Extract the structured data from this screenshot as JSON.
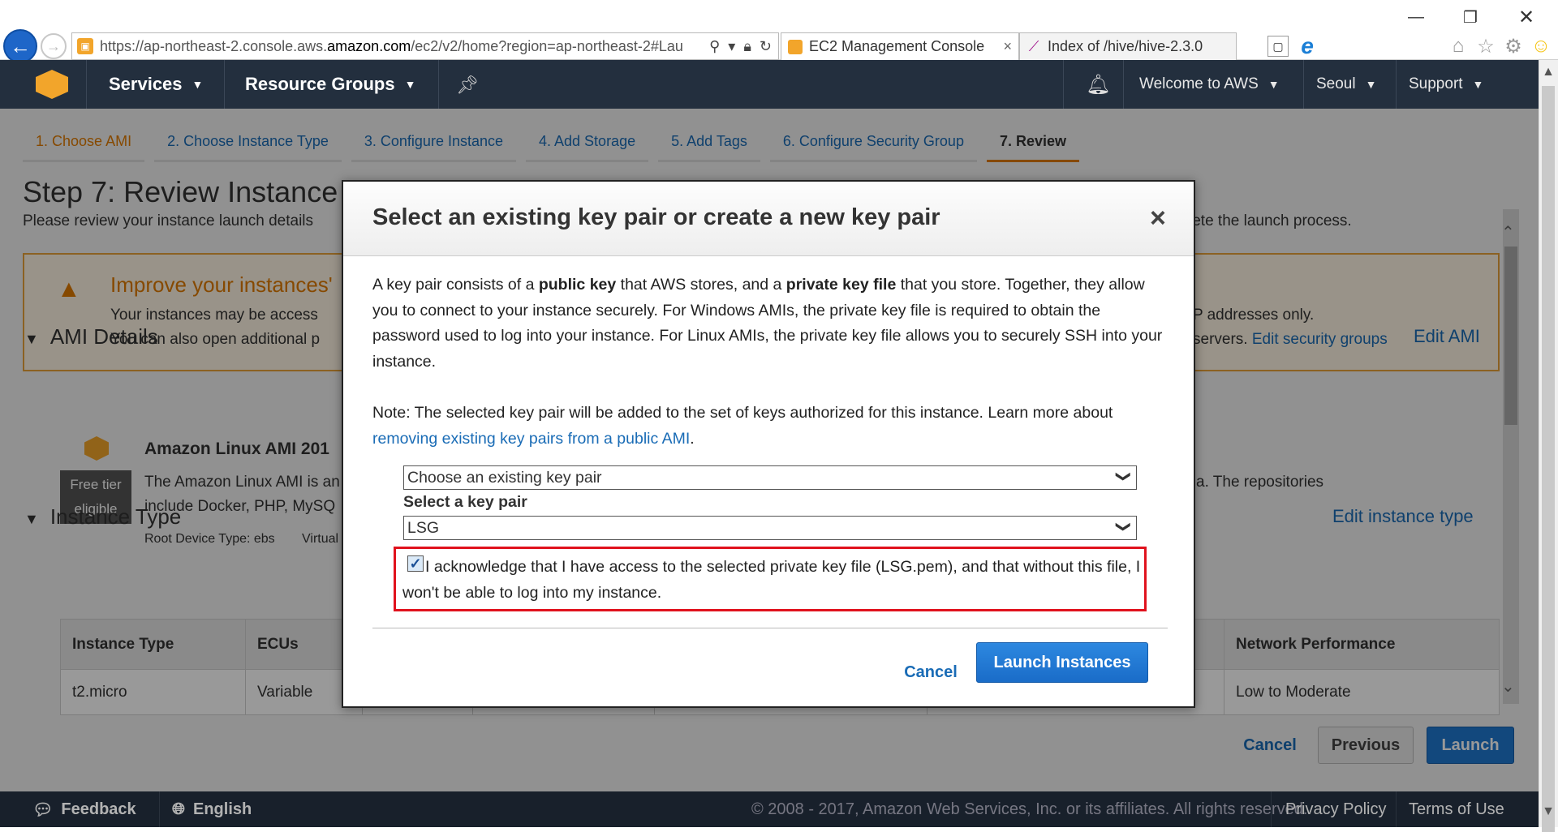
{
  "browser": {
    "url_prefix": "https://ap-northeast-2.console.aws.",
    "url_domain": "amazon.com",
    "url_suffix": "/ec2/v2/home?region=ap-northeast-2#Lau",
    "tabs": [
      {
        "title": "EC2 Management Console",
        "close": "×"
      },
      {
        "title": "Index of /hive/hive-2.3.0"
      }
    ],
    "back_glyph": "←",
    "forward_glyph": "→",
    "new_tab_glyph": "▢",
    "ie_glyph": "e"
  },
  "awsnav": {
    "services": "Services",
    "resource_groups": "Resource Groups",
    "welcome": "Welcome to AWS",
    "region": "Seoul",
    "support": "Support"
  },
  "wizard": {
    "steps": [
      "1. Choose AMI",
      "2. Choose Instance Type",
      "3. Configure Instance",
      "4. Add Storage",
      "5. Add Tags",
      "6. Configure Security Group",
      "7. Review"
    ],
    "title": "Step 7: Review Instance",
    "description_start": "Please review your instance launch details",
    "description_end": "lete the launch process."
  },
  "warning": {
    "title": "Improve your instances'",
    "line1_start": "Your instances may be access",
    "line1_end": "P addresses only.",
    "line2_start": "You can also open additional p",
    "line2_end": "servers.",
    "edit_link": "Edit security groups"
  },
  "ami": {
    "section": "AMI Details",
    "edit": "Edit AMI",
    "name": "Amazon Linux AMI 201",
    "free_tier_1": "Free tier",
    "free_tier_2": "eligible",
    "desc1": "The Amazon Linux AMI is an",
    "desc2": "include Docker, PHP, MySQ",
    "desc_tail": "a. The repositories",
    "root": "Root Device Type: ebs",
    "virt": "Virtual"
  },
  "instance_type": {
    "section": "Instance Type",
    "edit": "Edit instance type",
    "headers": [
      "Instance Type",
      "ECUs",
      "",
      "",
      "",
      "",
      "Network Performance"
    ],
    "row": [
      "t2.micro",
      "Variable",
      "",
      "",
      "",
      "",
      "Low to Moderate"
    ]
  },
  "page_buttons": {
    "cancel": "Cancel",
    "previous": "Previous",
    "launch": "Launch"
  },
  "modal": {
    "title": "Select an existing key pair or create a new key pair",
    "close": "×",
    "p1_a": "A key pair consists of a ",
    "p1_b": "public key",
    "p1_c": " that AWS stores, and a ",
    "p1_d": "private key file",
    "p1_e": " that you store. Together, they allow you to connect to your instance securely. For Windows AMIs, the private key file is required to obtain the password used to log into your instance. For Linux AMIs, the private key file allows you to securely SSH into your instance.",
    "note_a": "Note: The selected key pair will be added to the set of keys authorized for this instance. Learn more about ",
    "note_link": "removing existing key pairs from a public AMI",
    "note_b": ".",
    "mode_value": "Choose an existing key pair",
    "kp_label": "Select a key pair",
    "kp_value": "LSG",
    "ack_text": "I acknowledge that I have access to the selected private key file (LSG.pem), and that without this file, I won't be able to log into my instance.",
    "ack_checked": true,
    "cancel": "Cancel",
    "launch": "Launch Instances"
  },
  "footer": {
    "feedback": "Feedback",
    "language": "English",
    "copyright": "© 2008 - 2017, Amazon Web Services, Inc. or its affiliates. All rights reserved.",
    "privacy": "Privacy Policy",
    "terms": "Terms of Use"
  },
  "icons": {
    "warning": "warning-icon",
    "bell": "bell-icon",
    "pin": "pin-icon"
  },
  "colors": {
    "aws_nav": "#232f3e",
    "aws_orange": "#f2a52b",
    "link_blue": "#1a6cb6",
    "primary_button": "#1f78d1",
    "highlight_red": "#e0121d"
  }
}
